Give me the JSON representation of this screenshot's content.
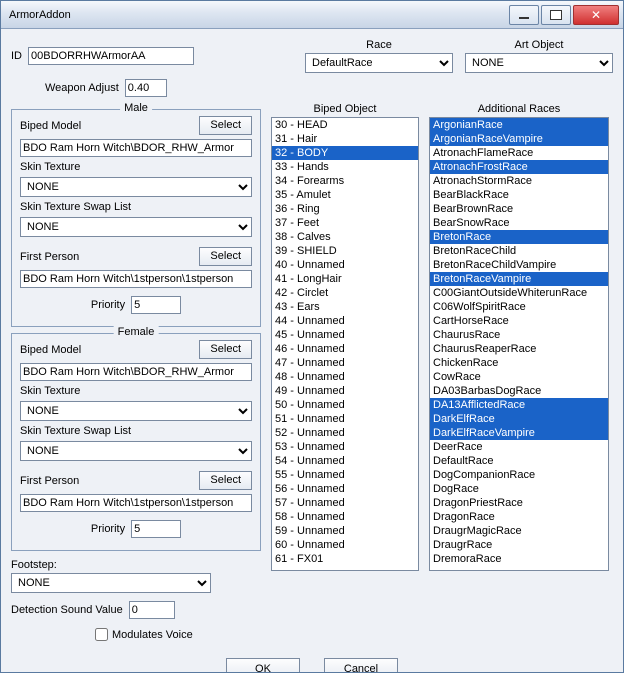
{
  "window": {
    "title": "ArmorAddon"
  },
  "labels": {
    "id": "ID",
    "weapon_adjust": "Weapon Adjust",
    "race": "Race",
    "art_object": "Art Object",
    "biped_model": "Biped Model",
    "select": "Select",
    "skin_texture": "Skin Texture",
    "skin_texture_swap": "Skin Texture Swap List",
    "first_person": "First Person",
    "priority": "Priority",
    "footstep": "Footstep:",
    "detection_sound": "Detection Sound Value",
    "modulates_voice": "Modulates Voice",
    "biped_object": "Biped Object",
    "additional_races": "Additional Races",
    "ok": "OK",
    "cancel": "Cancel",
    "male": "Male",
    "female": "Female"
  },
  "values": {
    "id": "00BDORRHWArmorAA",
    "weapon_adjust": "0.40",
    "race": "DefaultRace",
    "art_object": "NONE",
    "male": {
      "biped_model": "BDO Ram Horn Witch\\BDOR_RHW_Armor",
      "skin_texture": "NONE",
      "skin_texture_swap": "NONE",
      "first_person": "BDO Ram Horn Witch\\1stperson\\1stperson",
      "priority": "5"
    },
    "female": {
      "biped_model": "BDO Ram Horn Witch\\BDOR_RHW_Armor",
      "skin_texture": "NONE",
      "skin_texture_swap": "NONE",
      "first_person": "BDO Ram Horn Witch\\1stperson\\1stperson",
      "priority": "5"
    },
    "footstep": "NONE",
    "detection_sound": "0"
  },
  "biped_object": [
    {
      "t": "30 - HEAD",
      "s": false
    },
    {
      "t": "31 - Hair",
      "s": false
    },
    {
      "t": "32 - BODY",
      "s": true
    },
    {
      "t": "33 - Hands",
      "s": false
    },
    {
      "t": "34 - Forearms",
      "s": false
    },
    {
      "t": "35 - Amulet",
      "s": false
    },
    {
      "t": "36 - Ring",
      "s": false
    },
    {
      "t": "37 - Feet",
      "s": false
    },
    {
      "t": "38 - Calves",
      "s": false
    },
    {
      "t": "39 - SHIELD",
      "s": false
    },
    {
      "t": "40 - Unnamed",
      "s": false
    },
    {
      "t": "41 - LongHair",
      "s": false
    },
    {
      "t": "42 - Circlet",
      "s": false
    },
    {
      "t": "43 - Ears",
      "s": false
    },
    {
      "t": "44 - Unnamed",
      "s": false
    },
    {
      "t": "45 - Unnamed",
      "s": false
    },
    {
      "t": "46 - Unnamed",
      "s": false
    },
    {
      "t": "47 - Unnamed",
      "s": false
    },
    {
      "t": "48 - Unnamed",
      "s": false
    },
    {
      "t": "49 - Unnamed",
      "s": false
    },
    {
      "t": "50 - Unnamed",
      "s": false
    },
    {
      "t": "51 - Unnamed",
      "s": false
    },
    {
      "t": "52 - Unnamed",
      "s": false
    },
    {
      "t": "53 - Unnamed",
      "s": false
    },
    {
      "t": "54 - Unnamed",
      "s": false
    },
    {
      "t": "55 - Unnamed",
      "s": false
    },
    {
      "t": "56 - Unnamed",
      "s": false
    },
    {
      "t": "57 - Unnamed",
      "s": false
    },
    {
      "t": "58 - Unnamed",
      "s": false
    },
    {
      "t": "59 - Unnamed",
      "s": false
    },
    {
      "t": "60 - Unnamed",
      "s": false
    },
    {
      "t": "61 - FX01",
      "s": false
    }
  ],
  "additional_races": [
    {
      "t": "ArgonianRace",
      "s": true
    },
    {
      "t": "ArgonianRaceVampire",
      "s": true
    },
    {
      "t": "AtronachFlameRace",
      "s": false
    },
    {
      "t": "AtronachFrostRace",
      "s": true
    },
    {
      "t": "AtronachStormRace",
      "s": false
    },
    {
      "t": "BearBlackRace",
      "s": false
    },
    {
      "t": "BearBrownRace",
      "s": false
    },
    {
      "t": "BearSnowRace",
      "s": false
    },
    {
      "t": "BretonRace",
      "s": true
    },
    {
      "t": "BretonRaceChild",
      "s": false
    },
    {
      "t": "BretonRaceChildVampire",
      "s": false
    },
    {
      "t": "BretonRaceVampire",
      "s": true
    },
    {
      "t": "C00GiantOutsideWhiterunRace",
      "s": false
    },
    {
      "t": "C06WolfSpiritRace",
      "s": false
    },
    {
      "t": "CartHorseRace",
      "s": false
    },
    {
      "t": "ChaurusRace",
      "s": false
    },
    {
      "t": "ChaurusReaperRace",
      "s": false
    },
    {
      "t": "ChickenRace",
      "s": false
    },
    {
      "t": "CowRace",
      "s": false
    },
    {
      "t": "DA03BarbasDogRace",
      "s": false
    },
    {
      "t": "DA13AfflictedRace",
      "s": true
    },
    {
      "t": "DarkElfRace",
      "s": true
    },
    {
      "t": "DarkElfRaceVampire",
      "s": true
    },
    {
      "t": "DeerRace",
      "s": false
    },
    {
      "t": "DefaultRace",
      "s": false
    },
    {
      "t": "DogCompanionRace",
      "s": false
    },
    {
      "t": "DogRace",
      "s": false
    },
    {
      "t": "DragonPriestRace",
      "s": false
    },
    {
      "t": "DragonRace",
      "s": false
    },
    {
      "t": "DraugrMagicRace",
      "s": false
    },
    {
      "t": "DraugrRace",
      "s": false
    },
    {
      "t": "DremoraRace",
      "s": false
    }
  ]
}
